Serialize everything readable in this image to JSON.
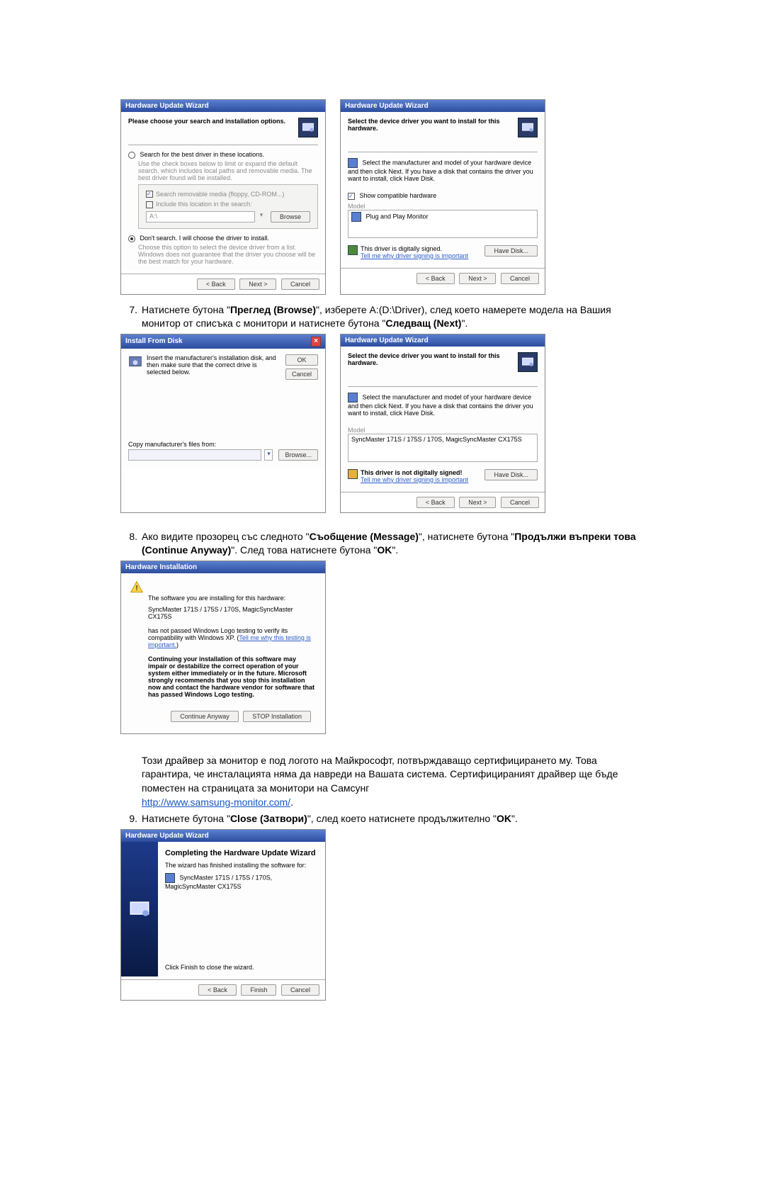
{
  "dialogs": {
    "d1": {
      "title": "Hardware Update Wizard",
      "prompt": "Please choose your search and installation options.",
      "radio1": "Search for the best driver in these locations.",
      "radio1desc": "Use the check boxes below to limit or expand the default search, which includes local paths and removable media. The best driver found will be installed.",
      "chk1": "Search removable media (floppy, CD-ROM...)",
      "chk2": "Include this location in the search:",
      "field": "A:\\",
      "browse": "Browse",
      "radio2": "Don't search. I will choose the driver to install.",
      "radio2desc": "Choose this option to select the device driver from a list. Windows does not guarantee that the driver you choose will be the best match for your hardware.",
      "back": "< Back",
      "next": "Next >",
      "cancel": "Cancel"
    },
    "d2": {
      "title": "Hardware Update Wizard",
      "prompt": "Select the device driver you want to install for this hardware.",
      "desc": "Select the manufacturer and model of your hardware device and then click Next. If you have a disk that contains the driver you want to install, click Have Disk.",
      "chk": "Show compatible hardware",
      "model": "Model",
      "item": "Plug and Play Monitor",
      "signed": "This driver is digitally signed.",
      "tell": "Tell me why driver signing is important",
      "havedisk": "Have Disk...",
      "back": "< Back",
      "next": "Next >",
      "cancel": "Cancel"
    },
    "d3": {
      "title": "Install From Disk",
      "desc": "Insert the manufacturer's installation disk, and then make sure that the correct drive is selected below.",
      "ok": "OK",
      "cancel": "Cancel",
      "copylabel": "Copy manufacturer's files from:",
      "field": "",
      "browse": "Browse..."
    },
    "d4": {
      "title": "Hardware Update Wizard",
      "prompt": "Select the device driver you want to install for this hardware.",
      "desc": "Select the manufacturer and model of your hardware device and then click Next. If you have a disk that contains the driver you want to install, click Have Disk.",
      "model": "Model",
      "item": "SyncMaster 171S / 175S / 170S, MagicSyncMaster CX175S",
      "notsigned": "This driver is not digitally signed!",
      "tell": "Tell me why driver signing is important",
      "havedisk": "Have Disk...",
      "back": "< Back",
      "next": "Next >",
      "cancel": "Cancel"
    },
    "d5": {
      "title": "Hardware Installation",
      "l1": "The software you are installing for this hardware:",
      "l2": "SyncMaster 171S / 175S / 170S, MagicSyncMaster CX175S",
      "l3a": "has not passed Windows Logo testing to verify its compatibility with Windows XP. (",
      "l3link": "Tell me why this testing is important.",
      "l3b": ")",
      "l4": "Continuing your installation of this software may impair or destabilize the correct operation of your system either immediately or in the future. Microsoft strongly recommends that you stop this installation now and contact the hardware vendor for software that has passed Windows Logo testing.",
      "cont": "Continue Anyway",
      "stop": "STOP Installation"
    },
    "d6": {
      "title": "Hardware Update Wizard",
      "head": "Completing the Hardware Update Wizard",
      "l1": "The wizard has finished installing the software for:",
      "l2": "SyncMaster 171S / 175S / 170S, MagicSyncMaster CX175S",
      "l3": "Click Finish to close the wizard.",
      "back": "< Back",
      "finish": "Finish",
      "cancel": "Cancel"
    }
  },
  "text": {
    "step7_a": "Натиснете бутона \"",
    "step7_b": "Преглед (Browse)",
    "step7_c": "\", изберете A:(D:\\Driver), след което намерете модела на Вашия монитор от списъка с монитори и натиснете бутона \"",
    "step7_d": "Следващ (Next)",
    "step7_e": "\".",
    "step8_a": "Ако видите прозорец със следното \"",
    "step8_b": "Съобщение (Message)",
    "step8_c": "\", натиснете бутона \"",
    "step8_d": "Продължи въпреки това (Continue Anyway)",
    "step8_e": "\". След това натиснете бутона \"",
    "step8_f": "OK",
    "step8_g": "\".",
    "para_a": "Този драйвер за монитор е под логото на Майкрософт, потвърждаващо сертифицирането му. Това гарантира, че инсталацията няма да навреди на Вашата система. Сертифицираният драйвер ще бъде поместен на страницата за монитори на Самсунг",
    "para_link": "http://www.samsung-monitor.com/",
    "step9_a": "Натиснете бутона \"",
    "step9_b": "Close (Затвори)",
    "step9_c": "\", след което натиснете продължително \"",
    "step9_d": "OK",
    "step9_e": "\".",
    "num7": "7.",
    "num8": "8.",
    "num9": "9."
  }
}
